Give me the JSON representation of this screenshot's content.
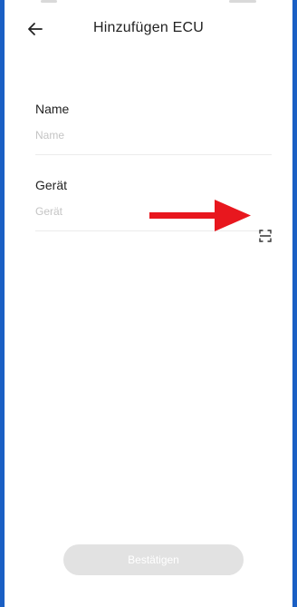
{
  "header": {
    "title": "Hinzufügen ECU",
    "back_icon": "back-arrow-icon"
  },
  "form": {
    "name": {
      "label": "Name",
      "placeholder": "Name",
      "value": ""
    },
    "device": {
      "label": "Gerät",
      "placeholder": "Gerät",
      "value": "",
      "scan_icon": "scan-icon"
    }
  },
  "annotation": {
    "arrow_color": "#e8171e"
  },
  "footer": {
    "confirm_label": "Bestätigen"
  },
  "colors": {
    "frame": "#1a5fc4",
    "background": "#ffffff",
    "button_disabled": "#e2e2e2",
    "placeholder": "#c4c4c4"
  }
}
